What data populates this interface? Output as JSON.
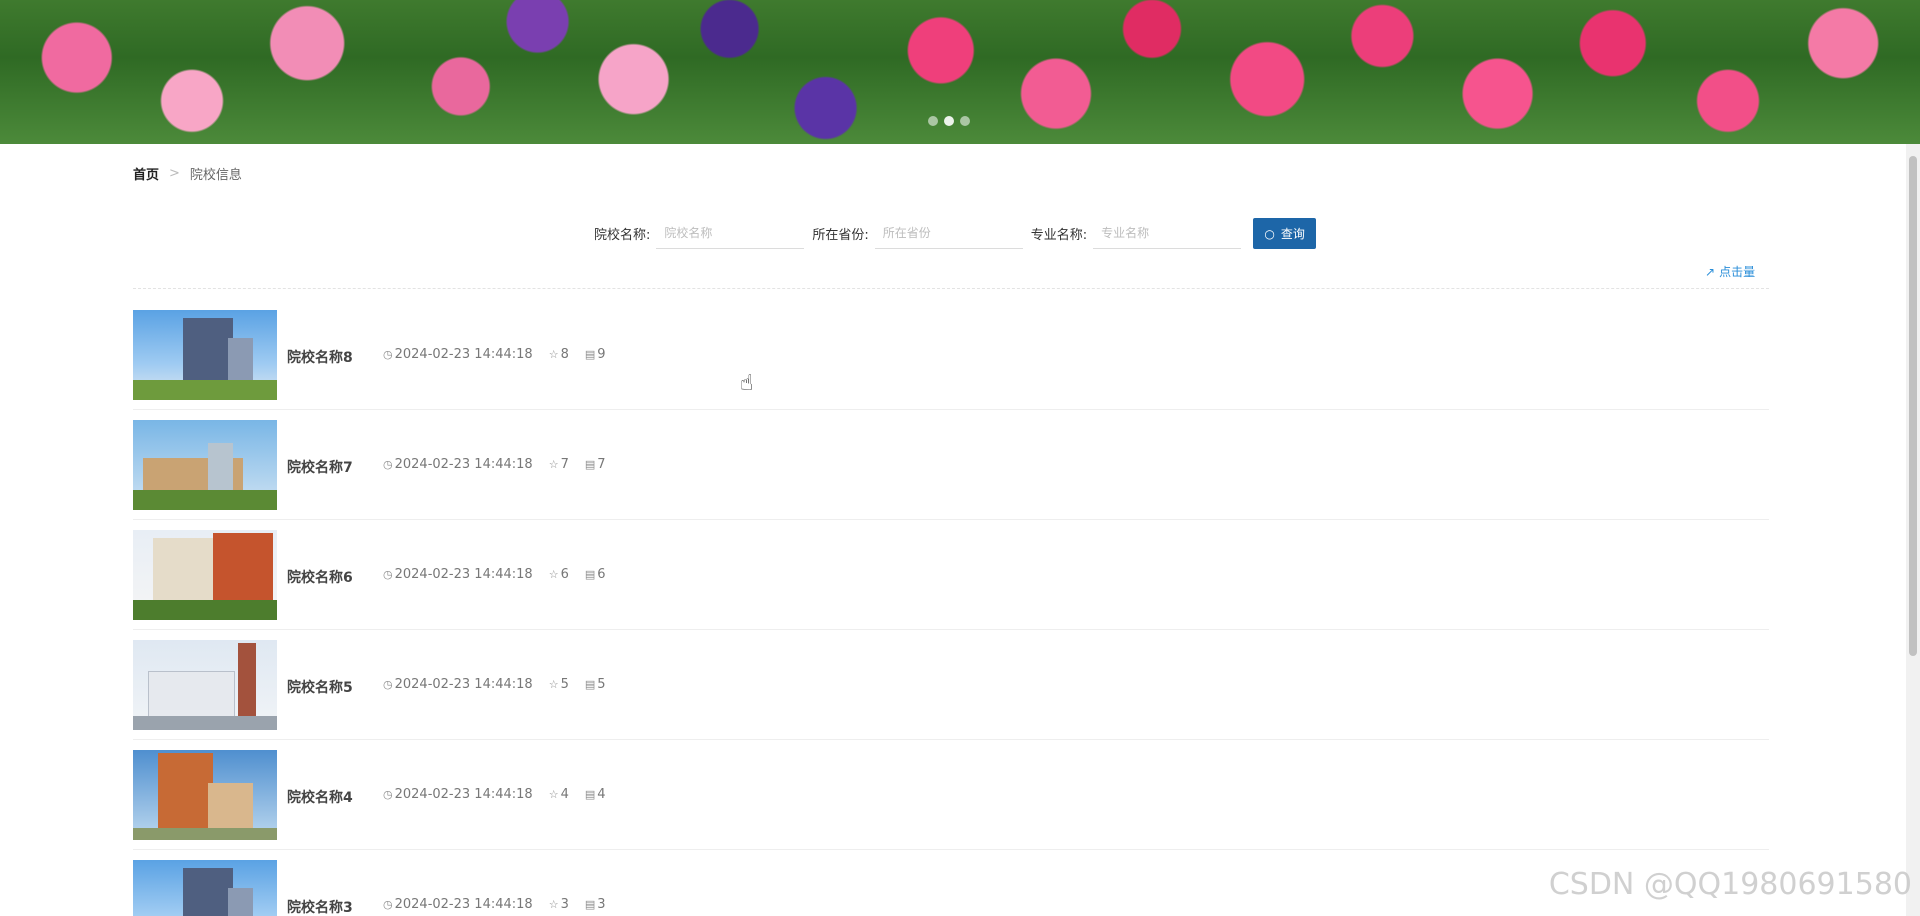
{
  "breadcrumb": {
    "home": "首页",
    "separator": ">",
    "current": "院校信息"
  },
  "search": {
    "school_label": "院校名称:",
    "school_placeholder": "院校名称",
    "province_label": "所在省份:",
    "province_placeholder": "所在省份",
    "major_label": "专业名称:",
    "major_placeholder": "专业名称",
    "button_label": "查询"
  },
  "sort": {
    "label": "点击量"
  },
  "items": [
    {
      "title": "院校名称8",
      "time": "2024-02-23 14:44:18",
      "stars": "8",
      "views": "9"
    },
    {
      "title": "院校名称7",
      "time": "2024-02-23 14:44:18",
      "stars": "7",
      "views": "7"
    },
    {
      "title": "院校名称6",
      "time": "2024-02-23 14:44:18",
      "stars": "6",
      "views": "6"
    },
    {
      "title": "院校名称5",
      "time": "2024-02-23 14:44:18",
      "stars": "5",
      "views": "5"
    },
    {
      "title": "院校名称4",
      "time": "2024-02-23 14:44:18",
      "stars": "4",
      "views": "4"
    },
    {
      "title": "院校名称3",
      "time": "2024-02-23 14:44:18",
      "stars": "3",
      "views": "3"
    }
  ],
  "watermark": "CSDN @QQ1980691580",
  "colors": {
    "primary_button": "#1d66a8",
    "link": "#2a8ed8"
  }
}
